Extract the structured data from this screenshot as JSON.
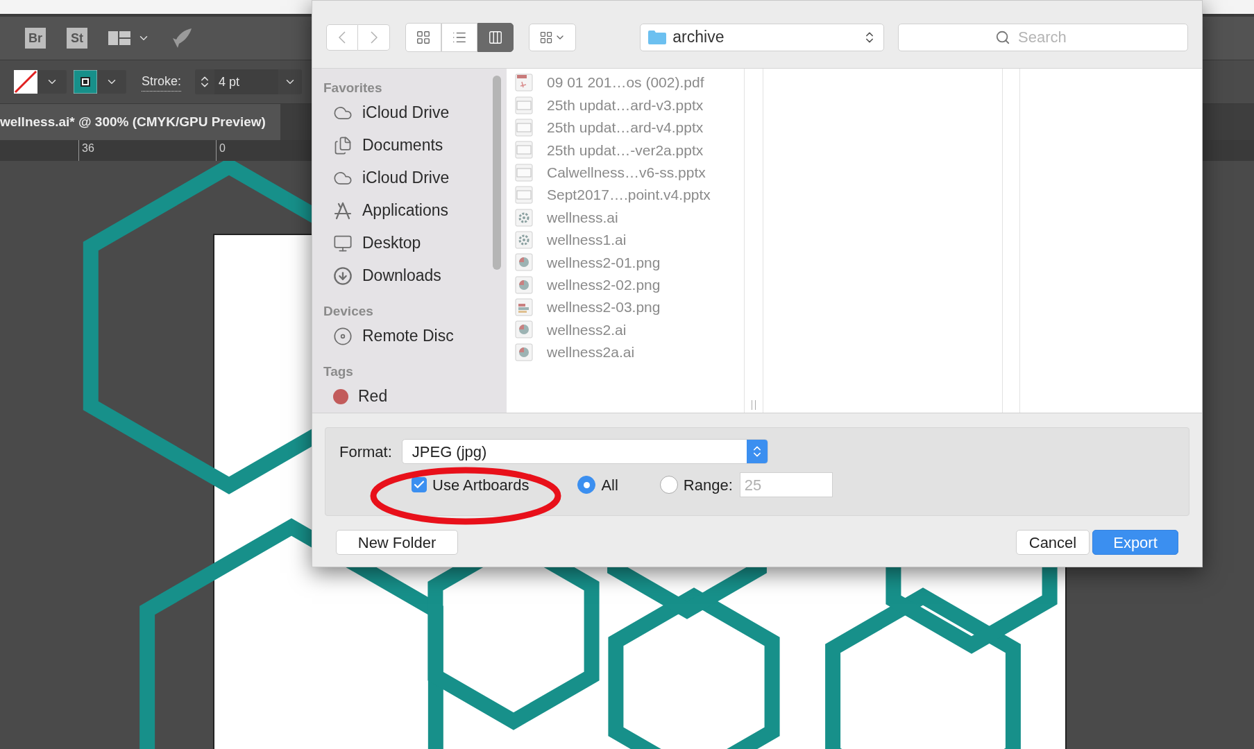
{
  "app": {
    "toolbar_buttons": [
      "Br",
      "St"
    ],
    "stroke_label": "Stroke:",
    "stroke_value": "4 pt",
    "document_tab": "wellness.ai* @ 300% (CMYK/GPU Preview)",
    "ruler_marks": [
      "36",
      "0"
    ]
  },
  "dialog": {
    "view_modes": [
      {
        "kind": "icons",
        "selected": false
      },
      {
        "kind": "list",
        "selected": false
      },
      {
        "kind": "columns",
        "selected": true
      }
    ],
    "location": "archive",
    "search_placeholder": "Search",
    "sidebar": [
      {
        "heading": "Favorites",
        "items": [
          {
            "label": "iCloud Drive",
            "kind": "cloud"
          },
          {
            "label": "Documents",
            "kind": "documents"
          },
          {
            "label": "iCloud Drive",
            "kind": "cloud"
          },
          {
            "label": "Applications",
            "kind": "applications"
          },
          {
            "label": "Desktop",
            "kind": "desktop"
          },
          {
            "label": "Downloads",
            "kind": "downloads"
          }
        ]
      },
      {
        "heading": "Devices",
        "items": [
          {
            "label": "Remote Disc",
            "kind": "disc"
          }
        ]
      },
      {
        "heading": "Tags",
        "items": [
          {
            "label": "Red",
            "kind": "tag",
            "color": "#c25b5b"
          }
        ]
      }
    ],
    "files": [
      {
        "name": "09 01 201…os (002).pdf",
        "kind": "pdf"
      },
      {
        "name": "25th updat…ard-v3.pptx",
        "kind": "slides"
      },
      {
        "name": "25th updat…ard-v4.pptx",
        "kind": "slides"
      },
      {
        "name": "25th updat…-ver2a.pptx",
        "kind": "slides"
      },
      {
        "name": "Calwellness…v6-ss.pptx",
        "kind": "slides"
      },
      {
        "name": "Sept2017….point.v4.pptx",
        "kind": "slides"
      },
      {
        "name": "wellness.ai",
        "kind": "gear"
      },
      {
        "name": "wellness1.ai",
        "kind": "gear"
      },
      {
        "name": "wellness2-01.png",
        "kind": "pie"
      },
      {
        "name": "wellness2-02.png",
        "kind": "pie"
      },
      {
        "name": "wellness2-03.png",
        "kind": "bars"
      },
      {
        "name": "wellness2.ai",
        "kind": "pie"
      },
      {
        "name": "wellness2a.ai",
        "kind": "pie"
      }
    ],
    "format_label": "Format:",
    "format_value": "JPEG (jpg)",
    "use_artboards": {
      "label": "Use Artboards",
      "checked": true
    },
    "range_options": [
      {
        "label": "All",
        "selected": true
      },
      {
        "label": "Range:",
        "selected": false
      }
    ],
    "range_field": {
      "value": "25",
      "disabled": true
    },
    "buttons": [
      {
        "label": "New Folder",
        "kind": "secondary"
      },
      {
        "label": "Cancel",
        "kind": "secondary"
      },
      {
        "label": "Export",
        "kind": "primary"
      }
    ]
  }
}
